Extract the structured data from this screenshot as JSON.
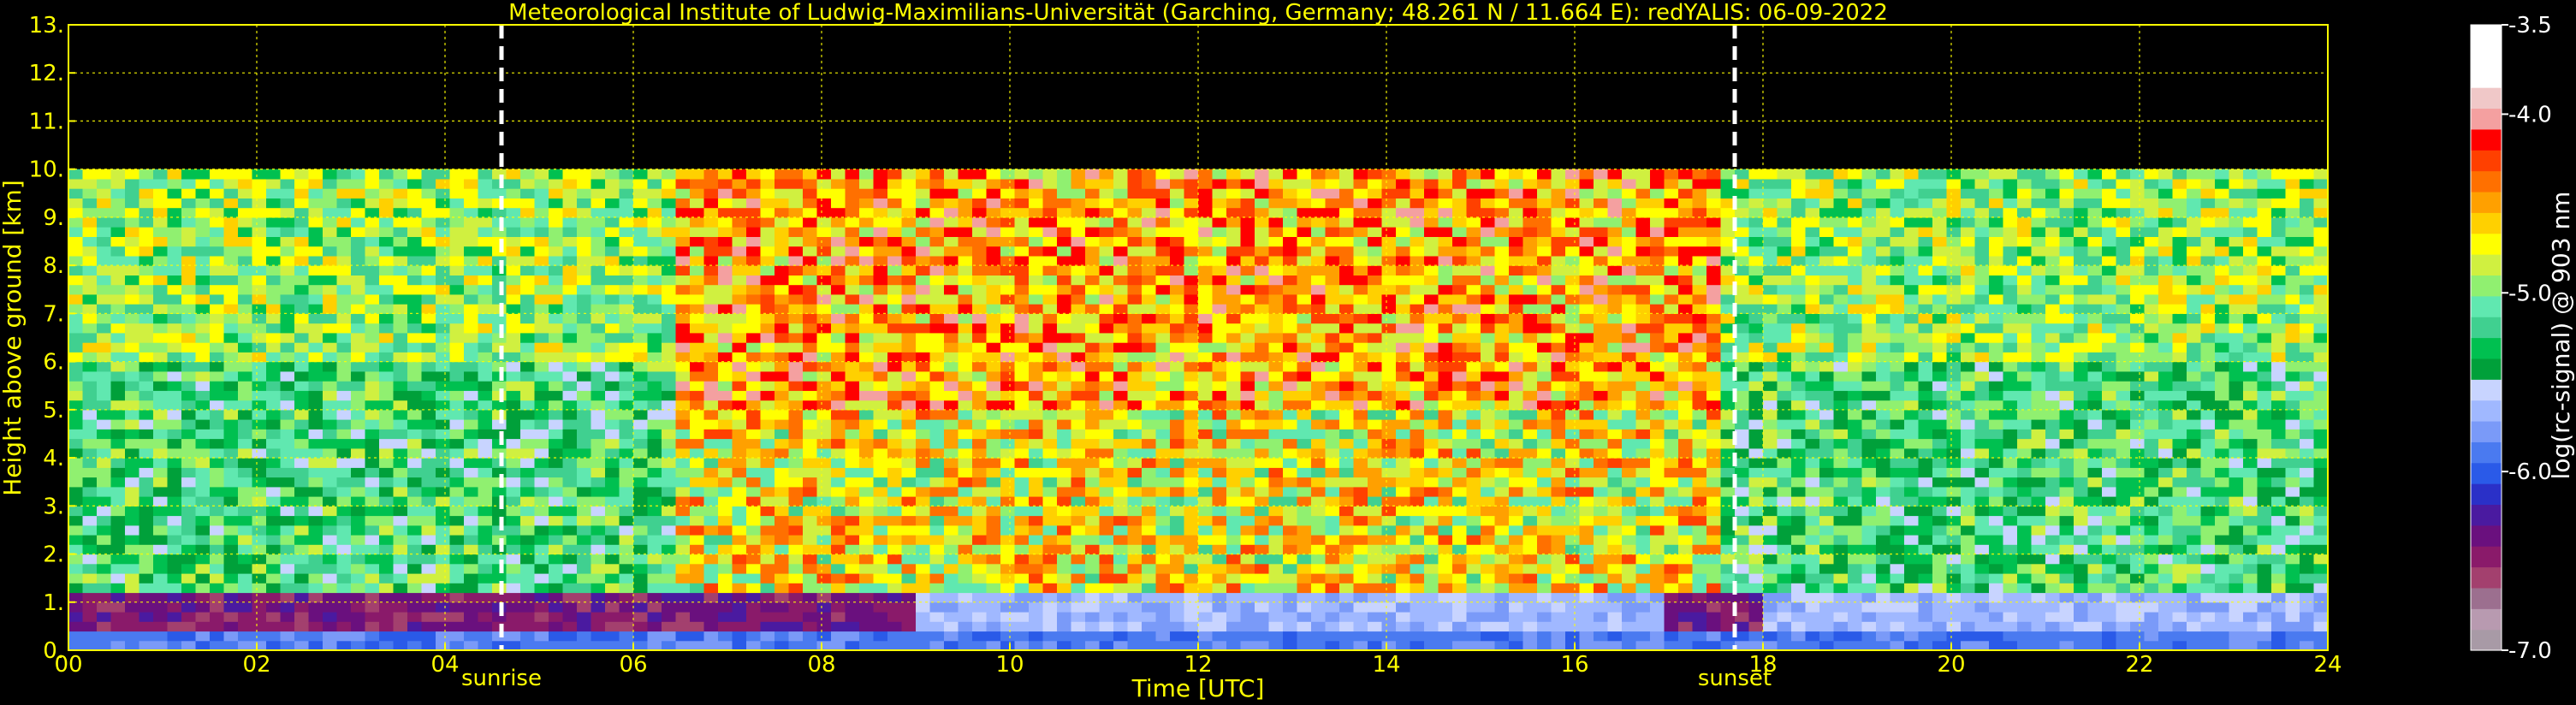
{
  "chart_data": {
    "type": "heatmap",
    "title": "Meteorological Institute of Ludwig-Maximilians-Universität (Garching, Germany; 48.261 N / 11.664 E):    redYALIS: 06-09-2022",
    "xlabel": "Time [UTC]",
    "ylabel": "Height above ground [km]",
    "xlim": [
      0,
      24
    ],
    "ylim": [
      0,
      13
    ],
    "x_ticks": [
      0,
      2,
      4,
      6,
      8,
      10,
      12,
      14,
      16,
      18,
      20,
      22,
      24
    ],
    "x_tick_labels": [
      "00",
      "02",
      "04",
      "06",
      "08",
      "10",
      "12",
      "14",
      "16",
      "18",
      "20",
      "22",
      "24"
    ],
    "y_ticks": [
      0,
      1,
      2,
      3,
      4,
      5,
      6,
      7,
      8,
      9,
      10,
      11,
      12,
      13
    ],
    "y_tick_labels": [
      "0.",
      "1.",
      "2.",
      "3.",
      "4.",
      "5.",
      "6.",
      "7.",
      "8.",
      "9.",
      "10.",
      "11.",
      "12.",
      "13."
    ],
    "grid": true,
    "data_top_km": 10,
    "events": [
      {
        "label": "sunrise",
        "time": 4.6
      },
      {
        "label": "sunset",
        "time": 17.7
      }
    ],
    "colorbar": {
      "label": "log(rc-signal) @ 903 nm",
      "range": [
        -7.0,
        -3.5
      ],
      "ticks": [
        -3.5,
        -4.0,
        -5.0,
        -6.0,
        -7.0
      ],
      "tick_labels": [
        "-3.5",
        "-4.0",
        "-5.0",
        "-6.0",
        "-7.0"
      ],
      "colors": [
        "#a89aa6",
        "#b89ab0",
        "#9c6f8f",
        "#a3406e",
        "#8a1a6a",
        "#6a107e",
        "#4a1aa0",
        "#2a30c8",
        "#2a5ae8",
        "#4a7af0",
        "#7a9af8",
        "#a0b8ff",
        "#c8d4ff",
        "#00a03a",
        "#00c050",
        "#40d090",
        "#60e8b0",
        "#90f070",
        "#d0f040",
        "#ffff00",
        "#ffd000",
        "#ffa000",
        "#ff7000",
        "#ff4000",
        "#ff0000",
        "#f4a0a0",
        "#f0c8c8",
        "#ffffff",
        "#ffffff",
        "#ffffff"
      ]
    }
  }
}
